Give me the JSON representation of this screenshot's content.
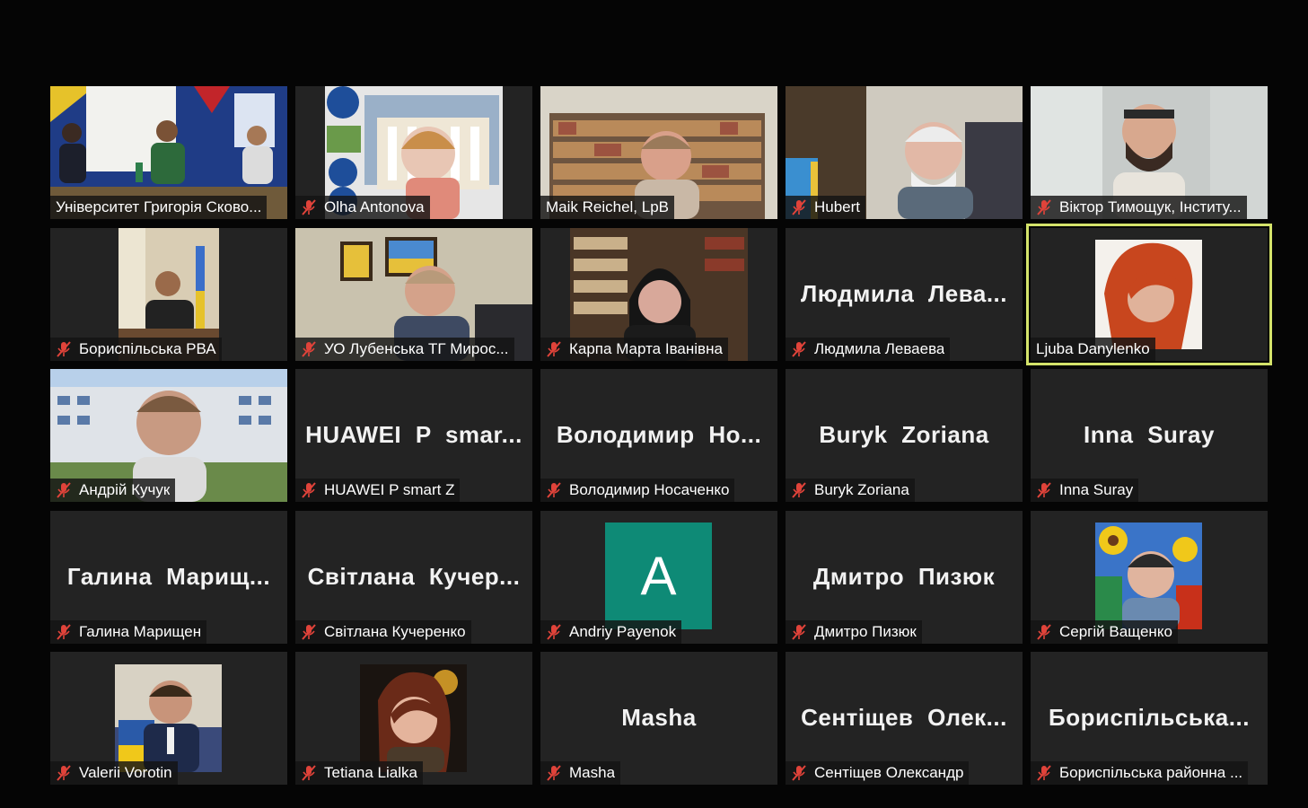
{
  "meeting": {
    "layout": "gallery",
    "colors": {
      "background": "#050505",
      "tile": "#232323",
      "active_speaker_border": "#d4e36a",
      "muted_icon": "#e0433a"
    },
    "participants": [
      {
        "name": "Університет Григорія Сково...",
        "display_name": "",
        "muted": false,
        "video": true,
        "active": false
      },
      {
        "name": "Olha Antonova",
        "display_name": "",
        "muted": true,
        "video": true,
        "active": false
      },
      {
        "name": "Maik Reichel, LpB",
        "display_name": "",
        "muted": false,
        "video": true,
        "active": false
      },
      {
        "name": "Hubert",
        "display_name": "",
        "muted": true,
        "video": true,
        "active": false
      },
      {
        "name": "Віктор Тимощук, Інститу...",
        "display_name": "",
        "muted": true,
        "video": true,
        "active": false
      },
      {
        "name": "Бориспільська РВА",
        "display_name": "",
        "muted": true,
        "video": true,
        "active": false
      },
      {
        "name": "УО Лубенська ТГ Мирос...",
        "display_name": "",
        "muted": true,
        "video": true,
        "active": false
      },
      {
        "name": "Карпа Марта Іванівна",
        "display_name": "",
        "muted": true,
        "video": true,
        "active": false
      },
      {
        "name": "Людмила Леваева",
        "display_name": "Людмила  Лева...",
        "muted": true,
        "video": false,
        "active": false
      },
      {
        "name": "Ljuba Danylenko",
        "display_name": "",
        "muted": false,
        "video": true,
        "active": true
      },
      {
        "name": "Андрій Кучук",
        "display_name": "",
        "muted": true,
        "video": true,
        "active": false
      },
      {
        "name": "HUAWEI P smart Z",
        "display_name": "HUAWEI  P  smar...",
        "muted": true,
        "video": false,
        "active": false
      },
      {
        "name": "Володимир Носаченко",
        "display_name": "Володимир  Но...",
        "muted": true,
        "video": false,
        "active": false
      },
      {
        "name": "Buryk Zoriana",
        "display_name": "Buryk Zoriana",
        "muted": true,
        "video": false,
        "active": false
      },
      {
        "name": "Inna Suray",
        "display_name": "Inna Suray",
        "muted": true,
        "video": false,
        "active": false
      },
      {
        "name": "Галина Марищен",
        "display_name": "Галина  Марищ...",
        "muted": true,
        "video": false,
        "active": false
      },
      {
        "name": "Світлана Кучеренко",
        "display_name": "Світлана  Кучер...",
        "muted": true,
        "video": false,
        "active": false
      },
      {
        "name": "Andriy Payenok",
        "display_name": "",
        "avatar_letter": "A",
        "muted": true,
        "video": false,
        "active": false
      },
      {
        "name": "Дмитро Пизюк",
        "display_name": "Дмитро Пизюк",
        "muted": true,
        "video": false,
        "active": false
      },
      {
        "name": "Сергій Ващенко",
        "display_name": "",
        "muted": true,
        "video": true,
        "active": false
      },
      {
        "name": "Valerii Vorotin",
        "display_name": "",
        "muted": true,
        "video": true,
        "active": false
      },
      {
        "name": "Tetiana Lialka",
        "display_name": "",
        "muted": true,
        "video": true,
        "active": false
      },
      {
        "name": "Masha",
        "display_name": "Masha",
        "muted": true,
        "video": false,
        "active": false
      },
      {
        "name": "Сентіщев Олександр",
        "display_name": "Сентіщев  Олек...",
        "muted": true,
        "video": false,
        "active": false
      },
      {
        "name": "Бориспільська районна ...",
        "display_name": "Бориспільська...",
        "muted": true,
        "video": false,
        "active": false
      }
    ]
  }
}
